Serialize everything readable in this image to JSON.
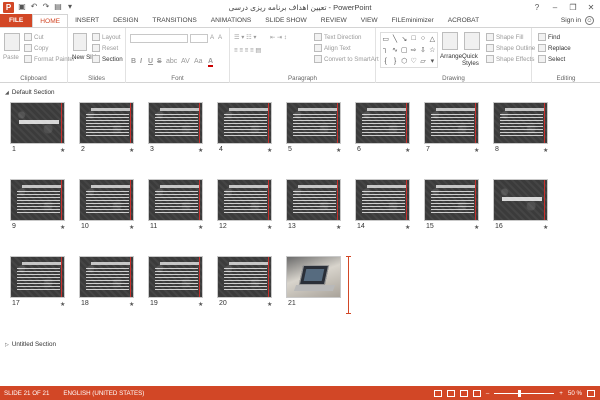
{
  "window": {
    "title": "تعیین اهداف برنامه ریزی درسی - PowerPoint",
    "help": "?",
    "minimize": "–",
    "maximize": "❐",
    "close": "✕"
  },
  "tabs": [
    {
      "label": "FILE"
    },
    {
      "label": "HOME"
    },
    {
      "label": "INSERT"
    },
    {
      "label": "DESIGN"
    },
    {
      "label": "TRANSITIONS"
    },
    {
      "label": "ANIMATIONS"
    },
    {
      "label": "SLIDE SHOW"
    },
    {
      "label": "REVIEW"
    },
    {
      "label": "VIEW"
    },
    {
      "label": "FILEminimizer"
    },
    {
      "label": "ACROBAT"
    }
  ],
  "account": {
    "sign_in": "Sign in"
  },
  "ribbon": {
    "clipboard": {
      "label": "Clipboard",
      "paste": "Paste",
      "cut": "Cut",
      "copy": "Copy",
      "format_painter": "Format Painter"
    },
    "slides": {
      "label": "Slides",
      "new_slide": "New Slide",
      "layout": "Layout",
      "reset": "Reset",
      "section": "Section"
    },
    "font": {
      "label": "Font",
      "bold": "B",
      "italic": "I",
      "underline": "U",
      "strike": "S",
      "shadow": "abc",
      "spacing": "AV",
      "case": "Aa",
      "color": "A"
    },
    "paragraph": {
      "label": "Paragraph",
      "text_direction": "Text Direction",
      "align_text": "Align Text",
      "convert_smartart": "Convert to SmartArt"
    },
    "drawing": {
      "label": "Drawing",
      "arrange": "Arrange",
      "quick_styles": "Quick Styles",
      "shape_fill": "Shape Fill",
      "shape_outline": "Shape Outline",
      "shape_effects": "Shape Effects"
    },
    "editing": {
      "label": "Editing",
      "find": "Find",
      "replace": "Replace",
      "select": "Select"
    }
  },
  "sections": [
    {
      "name": "Default Section"
    },
    {
      "name": "Untitled Section"
    }
  ],
  "slides": [
    {
      "num": "1",
      "kind": "title"
    },
    {
      "num": "2",
      "kind": "text"
    },
    {
      "num": "3",
      "kind": "text"
    },
    {
      "num": "4",
      "kind": "text"
    },
    {
      "num": "5",
      "kind": "text"
    },
    {
      "num": "6",
      "kind": "text"
    },
    {
      "num": "7",
      "kind": "text"
    },
    {
      "num": "8",
      "kind": "text"
    },
    {
      "num": "9",
      "kind": "text"
    },
    {
      "num": "10",
      "kind": "text"
    },
    {
      "num": "11",
      "kind": "text"
    },
    {
      "num": "12",
      "kind": "text"
    },
    {
      "num": "13",
      "kind": "text"
    },
    {
      "num": "14",
      "kind": "text"
    },
    {
      "num": "15",
      "kind": "text"
    },
    {
      "num": "16",
      "kind": "title"
    },
    {
      "num": "17",
      "kind": "text"
    },
    {
      "num": "18",
      "kind": "text"
    },
    {
      "num": "19",
      "kind": "text"
    },
    {
      "num": "20",
      "kind": "text"
    },
    {
      "num": "21",
      "kind": "photo"
    }
  ],
  "slide_star": "★",
  "status": {
    "slide_info": "SLIDE 21 OF 21",
    "language": "ENGLISH (UNITED STATES)",
    "zoom": "50 %",
    "zoom_minus": "–",
    "zoom_plus": "+"
  },
  "colors": {
    "accent": "#d24726",
    "status_bar": "#d24726"
  }
}
